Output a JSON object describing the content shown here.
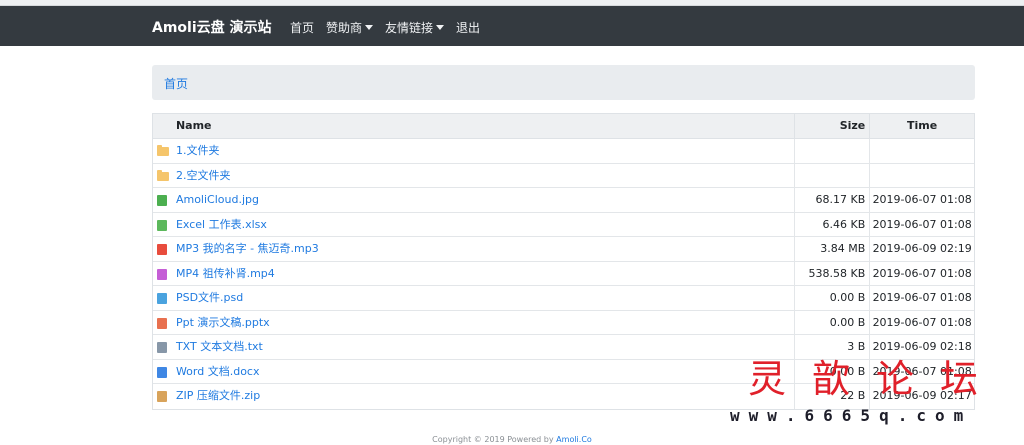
{
  "navbar": {
    "brand": "Amoli云盘 演示站",
    "items": [
      {
        "label": "首页",
        "dropdown": false
      },
      {
        "label": "赞助商",
        "dropdown": true
      },
      {
        "label": "友情链接",
        "dropdown": true
      },
      {
        "label": "退出",
        "dropdown": false
      }
    ]
  },
  "breadcrumb": {
    "home": "首页"
  },
  "table": {
    "headers": {
      "name": "Name",
      "size": "Size",
      "time": "Time"
    },
    "rows": [
      {
        "icon": "folder-icon",
        "name": "1.文件夹",
        "size": "",
        "time": ""
      },
      {
        "icon": "folder-icon",
        "name": "2.空文件夹",
        "size": "",
        "time": ""
      },
      {
        "icon": "image-file-icon",
        "name": "AmoliCloud.jpg",
        "size": "68.17 KB",
        "time": "2019-06-07 01:08"
      },
      {
        "icon": "excel-file-icon",
        "name": "Excel 工作表.xlsx",
        "size": "6.46 KB",
        "time": "2019-06-07 01:08"
      },
      {
        "icon": "audio-file-icon",
        "name": "MP3 我的名字 - 焦迈奇.mp3",
        "size": "3.84 MB",
        "time": "2019-06-09 02:19"
      },
      {
        "icon": "video-file-icon",
        "name": "MP4 祖传补肾.mp4",
        "size": "538.58 KB",
        "time": "2019-06-07 01:08"
      },
      {
        "icon": "psd-file-icon",
        "name": "PSD文件.psd",
        "size": "0.00 B",
        "time": "2019-06-07 01:08"
      },
      {
        "icon": "ppt-file-icon",
        "name": "Ppt 演示文稿.pptx",
        "size": "0.00 B",
        "time": "2019-06-07 01:08"
      },
      {
        "icon": "text-file-icon",
        "name": "TXT 文本文档.txt",
        "size": "3 B",
        "time": "2019-06-09 02:18"
      },
      {
        "icon": "word-file-icon",
        "name": "Word 文档.docx",
        "size": "0.00 B",
        "time": "2019-06-07 01:08"
      },
      {
        "icon": "zip-file-icon",
        "name": "ZIP 压缩文件.zip",
        "size": "22 B",
        "time": "2019-06-09 02:17"
      }
    ]
  },
  "footer": {
    "text": "Copyright © 2019 Powered by ",
    "link": "Amoli.Co"
  },
  "watermark": {
    "text": "灵歆论坛",
    "url": "www.6665q.com"
  },
  "colors": {
    "navbar": "#343a40",
    "link": "#1f7ae0",
    "breadcrumb_bg": "#e9ecef",
    "watermark": "#e0202a"
  }
}
